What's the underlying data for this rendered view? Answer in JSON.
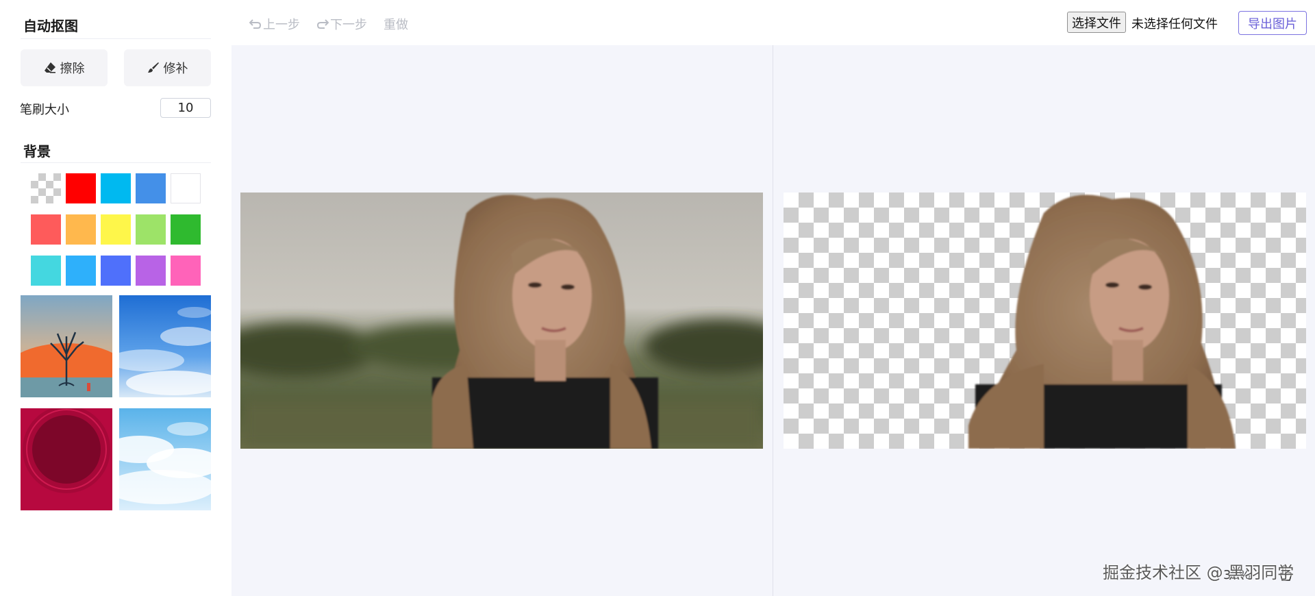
{
  "sidebar": {
    "title": "自动抠图",
    "tools": {
      "erase": "擦除",
      "repair": "修补"
    },
    "brush": {
      "label": "笔刷大小",
      "value": "10"
    },
    "background_title": "背景",
    "colors": [
      "transparent",
      "#ff0000",
      "#00b9f0",
      "#4490e8",
      "#ffffff",
      "#fe5b5b",
      "#ffb84d",
      "#fef64a",
      "#9de368",
      "#2fba2f",
      "#44d7e0",
      "#2eb0fb",
      "#4f70fb",
      "#b863e6",
      "#ff63b9"
    ],
    "bg_images": [
      "tree-sunset",
      "blue-sky",
      "red-circle",
      "light-clouds"
    ]
  },
  "toolbar": {
    "undo": "上一步",
    "redo": "下一步",
    "reset": "重做",
    "choose_file": "选择文件",
    "file_status": "未选择任何文件",
    "export": "导出图片"
  },
  "status": {
    "zoom": "32%"
  },
  "watermark": "掘金技术社区 @ 黑羽同学"
}
